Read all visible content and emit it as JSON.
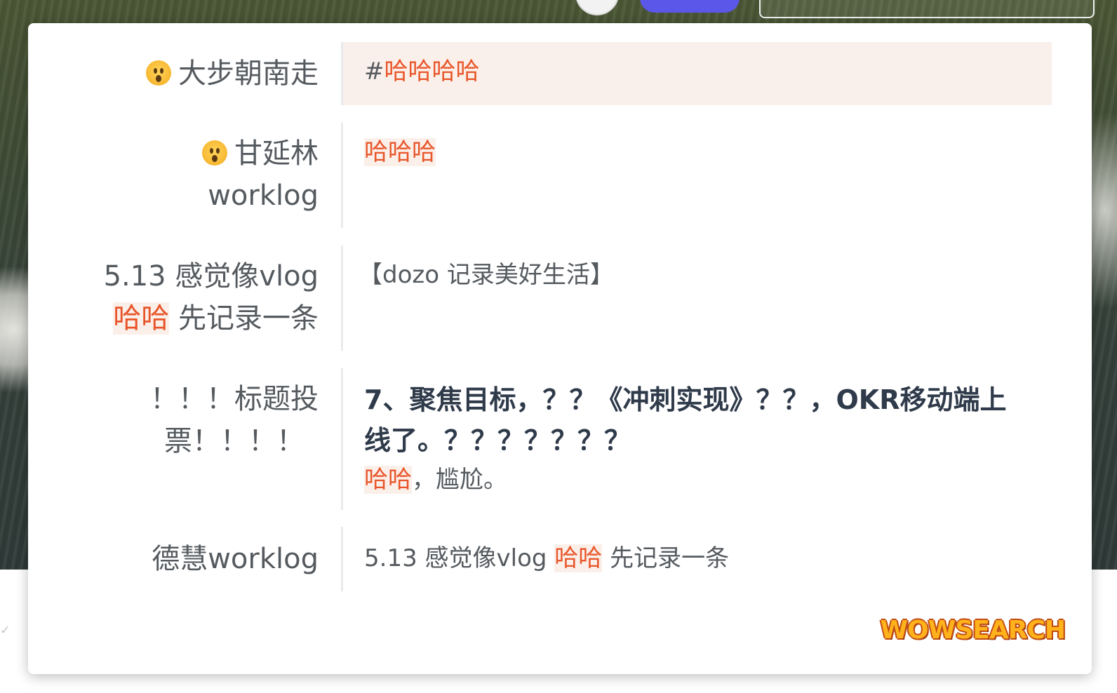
{
  "results": [
    {
      "title": "大步朝南走",
      "has_emoji": true,
      "snippet_prefix": "#",
      "snippet_hl": "哈哈哈哈"
    },
    {
      "title": "甘延林",
      "title_line2": "worklog",
      "has_emoji": true,
      "snippet_hl": "哈哈哈"
    },
    {
      "title_line1": "5.13 感觉像vlog",
      "title_hl": "哈哈",
      "title_after_hl": " 先记录一条",
      "snippet": "【dozo 记录美好生活】"
    },
    {
      "title_line1": "！！！标题投",
      "title_line2": "票！！！！",
      "snippet_bold_line1": "7、聚焦目标，？？《冲刺实现》？？，OKR移动端上",
      "snippet_bold_line2": "线了。？？？？？？？",
      "snippet_hl": "哈哈",
      "snippet_after_hl": "，尴尬。"
    },
    {
      "title": "德慧worklog",
      "snippet_before_hl": "5.13 感觉像vlog ",
      "snippet_hl": "哈哈",
      "snippet_after_hl": " 先记录一条"
    }
  ],
  "logo_text": "WOWSEARCH",
  "colors": {
    "highlight_text": "#e8562b",
    "highlight_bg": "#fbefe9",
    "selected_row_bg": "#faf0eb",
    "accent_purple": "#5b57e8"
  },
  "icons": [
    "astonished-emoji-icon",
    "chevron-down-icon"
  ]
}
